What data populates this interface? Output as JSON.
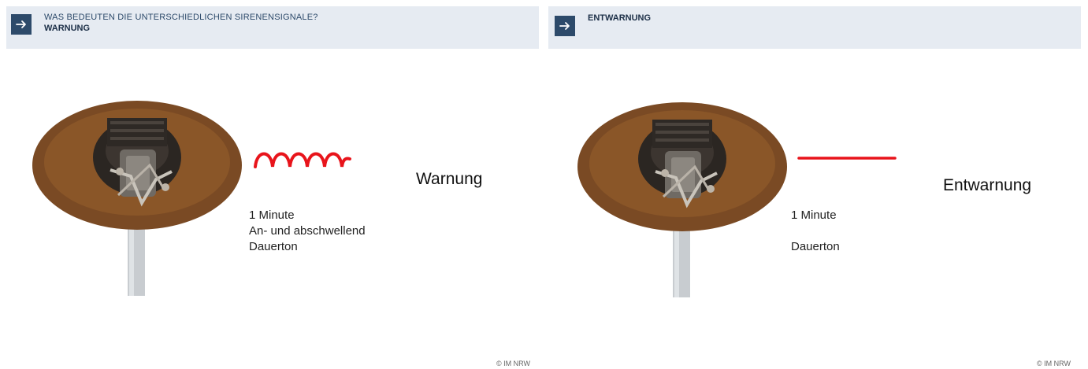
{
  "panels": [
    {
      "header_subtitle": "WAS BEDEUTEN DIE UNTERSCHIEDLICHEN SIRENENSIGNALE?",
      "header_title": "WARNUNG",
      "signal_label": "Warnung",
      "duration": "1 Minute",
      "pattern": "An- und abschwellend",
      "tone": "Dauerton",
      "credit": "© IM NRW",
      "wave_type": "oscillating"
    },
    {
      "header_title": "ENTWARNUNG",
      "signal_label": "Entwarnung",
      "duration": "1 Minute",
      "tone": "Dauerton",
      "credit": "© IM NRW",
      "wave_type": "flat"
    }
  ],
  "icons": {
    "header_arrow": "arrow-right-icon",
    "siren": "siren-icon"
  },
  "colors": {
    "banner_bg": "#e6ebf2",
    "arrow_box": "#2d4a6a",
    "signal_line": "#e8141b",
    "siren_dome": "#7a4a24"
  }
}
